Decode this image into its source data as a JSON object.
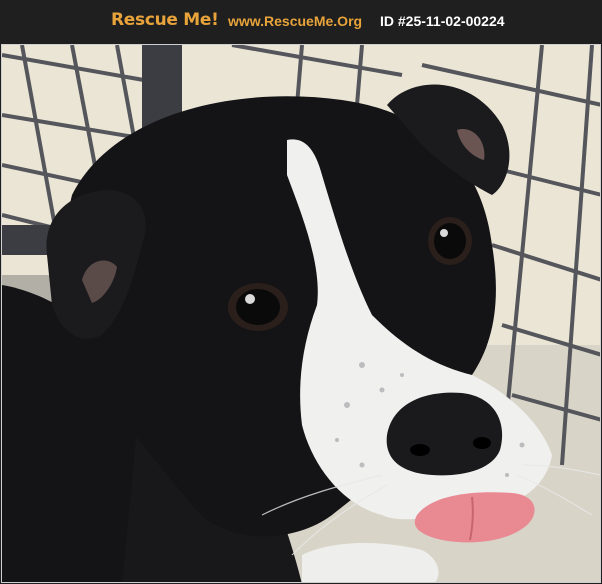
{
  "header": {
    "logo_text": "Rescue Me!",
    "site_url": "www.RescueMe.Org",
    "pet_id": "ID #25-11-02-00224"
  },
  "photo": {
    "subject": "black-and-white-puppy",
    "colors": {
      "header_bg": "#1f1f1f",
      "brand": "#e8a33a",
      "coat": "#121214",
      "blaze": "#f2f2f2",
      "tongue": "#e98a93",
      "wall": "#ece6d8",
      "fence": "#4a4a4e"
    }
  }
}
